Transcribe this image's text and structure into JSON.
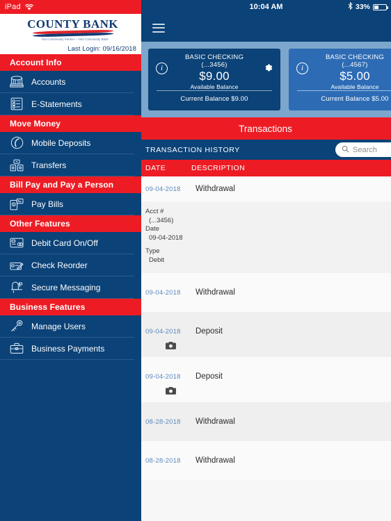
{
  "ipad_status": {
    "device_label": "iPad",
    "wifi_icon": "wifi-icon"
  },
  "ios_status": {
    "time": "10:04 AM",
    "bluetooth_icon": "bluetooth-icon",
    "battery_percent": "33%"
  },
  "brand": {
    "logo_text": "COUNTY BANK",
    "tagline": "Your Community Partner  ~  Your Community Bank",
    "last_login": "Last Login:  09/16/2018"
  },
  "navbar": {
    "menu_icon": "hamburger-menu-icon"
  },
  "sidebar": {
    "sections": [
      {
        "header": "Account Info",
        "items": [
          {
            "label": "Accounts",
            "icon": "bank-building-icon"
          },
          {
            "label": "E-Statements",
            "icon": "document-list-icon"
          }
        ]
      },
      {
        "header": "Move Money",
        "items": [
          {
            "label": "Mobile Deposits",
            "icon": "mobile-deposit-icon"
          },
          {
            "label": "Transfers",
            "icon": "transfer-icon"
          }
        ]
      },
      {
        "header": "Bill Pay and Pay a Person",
        "items": [
          {
            "label": "Pay Bills",
            "icon": "bill-pay-icon"
          }
        ]
      },
      {
        "header": "Other Features",
        "items": [
          {
            "label": "Debit Card On/Off",
            "icon": "debit-card-icon"
          },
          {
            "label": "Check Reorder",
            "icon": "check-icon"
          },
          {
            "label": "Secure Messaging",
            "icon": "mailbox-icon"
          }
        ]
      },
      {
        "header": "Business Features",
        "items": [
          {
            "label": "Manage Users",
            "icon": "key-icon"
          },
          {
            "label": "Business Payments",
            "icon": "briefcase-icon"
          }
        ]
      }
    ]
  },
  "accounts": [
    {
      "name": "BASIC CHECKING",
      "number": "(...3456)",
      "available": "$9.00",
      "available_label": "Available Balance",
      "current": "Current Balance $9.00",
      "info_icon": "info-icon",
      "settings_icon": "gear-icon"
    },
    {
      "name": "BASIC CHECKING",
      "number": "(...4567)",
      "available": "$5.00",
      "available_label": "Available Balance",
      "current": "Current Balance $5.00",
      "info_icon": "info-icon",
      "settings_icon": "gear-icon"
    }
  ],
  "transactions_panel": {
    "title": "Transactions",
    "history_title": "TRANSACTION HISTORY",
    "search_placeholder": "Search",
    "search_icon": "search-icon",
    "columns": {
      "date": "DATE",
      "description": "DESCRIPTION"
    },
    "rows": [
      {
        "date": "09-04-2018",
        "description": "Withdrawal",
        "camera": false,
        "expanded": true
      },
      {
        "date": "09-04-2018",
        "description": "Withdrawal",
        "camera": false,
        "expanded": false
      },
      {
        "date": "09-04-2018",
        "description": "Deposit",
        "camera": true,
        "expanded": false
      },
      {
        "date": "09-04-2018",
        "description": "Deposit",
        "camera": true,
        "expanded": false
      },
      {
        "date": "08-28-2018",
        "description": "Withdrawal",
        "camera": false,
        "expanded": false
      },
      {
        "date": "08-28-2018",
        "description": "Withdrawal",
        "camera": false,
        "expanded": false
      }
    ],
    "expanded_detail": {
      "acct_label": "Acct #",
      "acct_value": "(...3456)",
      "date_label": "Date",
      "date_value": "09-04-2018",
      "type_label": "Type",
      "type_value": "Debit"
    }
  },
  "colors": {
    "brand_red": "#ed1c24",
    "brand_navy": "#0b4277",
    "card_secondary": "#2d6cb5",
    "carousel_band": "#7da6cc",
    "date_blue": "#5b89c0"
  }
}
